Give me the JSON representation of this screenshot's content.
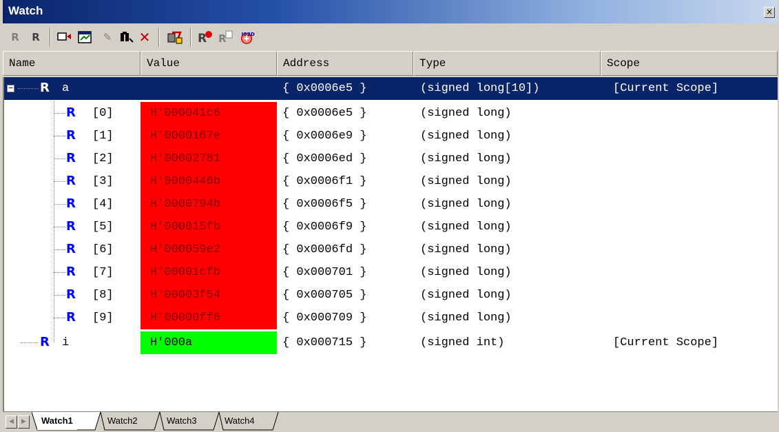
{
  "window": {
    "title": "Watch",
    "close_glyph": "×"
  },
  "toolbar": {
    "buttons": [
      {
        "name": "refresh-icon",
        "glyph": "R"
      },
      {
        "name": "refresh-all-icon",
        "glyph": "R"
      },
      {
        "name": "add-watch-icon",
        "glyph": "▭"
      },
      {
        "name": "edit-value-icon",
        "glyph": "▣"
      },
      {
        "name": "pencil-icon",
        "glyph": "✎"
      },
      {
        "name": "find-icon",
        "glyph": "♜"
      },
      {
        "name": "delete-icon",
        "glyph": "✕"
      },
      {
        "name": "display-format-icon",
        "glyph": "✦"
      },
      {
        "name": "radix-icon",
        "glyph": "R"
      },
      {
        "name": "copy-icon",
        "glyph": "R"
      },
      {
        "name": "record-icon",
        "glyph": "✸"
      }
    ]
  },
  "columns": [
    "Name",
    "Value",
    "Address",
    "Type",
    "Scope"
  ],
  "rows": [
    {
      "name": "a",
      "value": "",
      "address": "{ 0x0006e5 }",
      "type": "(signed long[10])",
      "scope": "[Current Scope]",
      "level": 0,
      "selected": true,
      "value_state": "none"
    },
    {
      "name": "[0]",
      "value": "H'000041c6",
      "address": "{ 0x0006e5 }",
      "type": "(signed long)",
      "scope": "",
      "level": 1,
      "value_state": "changed"
    },
    {
      "name": "[1]",
      "value": "H'0000167e",
      "address": "{ 0x0006e9 }",
      "type": "(signed long)",
      "scope": "",
      "level": 1,
      "value_state": "changed"
    },
    {
      "name": "[2]",
      "value": "H'00002781",
      "address": "{ 0x0006ed }",
      "type": "(signed long)",
      "scope": "",
      "level": 1,
      "value_state": "changed"
    },
    {
      "name": "[3]",
      "value": "H'0000446b",
      "address": "{ 0x0006f1 }",
      "type": "(signed long)",
      "scope": "",
      "level": 1,
      "value_state": "changed"
    },
    {
      "name": "[4]",
      "value": "H'0000794b",
      "address": "{ 0x0006f5 }",
      "type": "(signed long)",
      "scope": "",
      "level": 1,
      "value_state": "changed"
    },
    {
      "name": "[5]",
      "value": "H'000015fb",
      "address": "{ 0x0006f9 }",
      "type": "(signed long)",
      "scope": "",
      "level": 1,
      "value_state": "changed"
    },
    {
      "name": "[6]",
      "value": "H'000059e2",
      "address": "{ 0x0006fd }",
      "type": "(signed long)",
      "scope": "",
      "level": 1,
      "value_state": "changed"
    },
    {
      "name": "[7]",
      "value": "H'00001cfb",
      "address": "{ 0x000701 }",
      "type": "(signed long)",
      "scope": "",
      "level": 1,
      "value_state": "changed"
    },
    {
      "name": "[8]",
      "value": "H'00003f54",
      "address": "{ 0x000705 }",
      "type": "(signed long)",
      "scope": "",
      "level": 1,
      "value_state": "changed"
    },
    {
      "name": "[9]",
      "value": "H'00000ff6",
      "address": "{ 0x000709 }",
      "type": "(signed long)",
      "scope": "",
      "level": 1,
      "value_state": "changed"
    },
    {
      "name": "i",
      "value": "H'000a",
      "address": "{ 0x000715 }",
      "type": "(signed int)",
      "scope": "[Current Scope]",
      "level": 0,
      "value_state": "new"
    }
  ],
  "tabs": [
    "Watch1",
    "Watch2",
    "Watch3",
    "Watch4"
  ],
  "active_tab": "Watch1",
  "colors": {
    "changed_value_bg": "#ff0000",
    "new_value_bg": "#00ff00",
    "selection_bg": "#0a246a",
    "r_icon": "#0000ff"
  }
}
